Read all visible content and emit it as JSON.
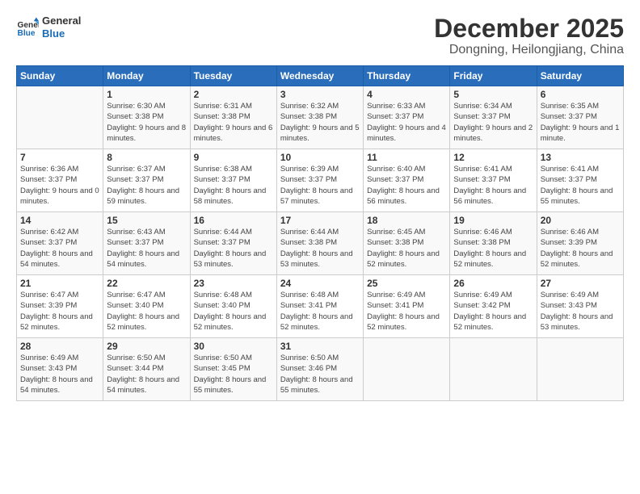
{
  "header": {
    "logo_line1": "General",
    "logo_line2": "Blue",
    "month": "December 2025",
    "location": "Dongning, Heilongjiang, China"
  },
  "days_of_week": [
    "Sunday",
    "Monday",
    "Tuesday",
    "Wednesday",
    "Thursday",
    "Friday",
    "Saturday"
  ],
  "weeks": [
    [
      {
        "day": "",
        "sunrise": "",
        "sunset": "",
        "daylight": ""
      },
      {
        "day": "1",
        "sunrise": "Sunrise: 6:30 AM",
        "sunset": "Sunset: 3:38 PM",
        "daylight": "Daylight: 9 hours and 8 minutes."
      },
      {
        "day": "2",
        "sunrise": "Sunrise: 6:31 AM",
        "sunset": "Sunset: 3:38 PM",
        "daylight": "Daylight: 9 hours and 6 minutes."
      },
      {
        "day": "3",
        "sunrise": "Sunrise: 6:32 AM",
        "sunset": "Sunset: 3:38 PM",
        "daylight": "Daylight: 9 hours and 5 minutes."
      },
      {
        "day": "4",
        "sunrise": "Sunrise: 6:33 AM",
        "sunset": "Sunset: 3:37 PM",
        "daylight": "Daylight: 9 hours and 4 minutes."
      },
      {
        "day": "5",
        "sunrise": "Sunrise: 6:34 AM",
        "sunset": "Sunset: 3:37 PM",
        "daylight": "Daylight: 9 hours and 2 minutes."
      },
      {
        "day": "6",
        "sunrise": "Sunrise: 6:35 AM",
        "sunset": "Sunset: 3:37 PM",
        "daylight": "Daylight: 9 hours and 1 minute."
      }
    ],
    [
      {
        "day": "7",
        "sunrise": "Sunrise: 6:36 AM",
        "sunset": "Sunset: 3:37 PM",
        "daylight": "Daylight: 9 hours and 0 minutes."
      },
      {
        "day": "8",
        "sunrise": "Sunrise: 6:37 AM",
        "sunset": "Sunset: 3:37 PM",
        "daylight": "Daylight: 8 hours and 59 minutes."
      },
      {
        "day": "9",
        "sunrise": "Sunrise: 6:38 AM",
        "sunset": "Sunset: 3:37 PM",
        "daylight": "Daylight: 8 hours and 58 minutes."
      },
      {
        "day": "10",
        "sunrise": "Sunrise: 6:39 AM",
        "sunset": "Sunset: 3:37 PM",
        "daylight": "Daylight: 8 hours and 57 minutes."
      },
      {
        "day": "11",
        "sunrise": "Sunrise: 6:40 AM",
        "sunset": "Sunset: 3:37 PM",
        "daylight": "Daylight: 8 hours and 56 minutes."
      },
      {
        "day": "12",
        "sunrise": "Sunrise: 6:41 AM",
        "sunset": "Sunset: 3:37 PM",
        "daylight": "Daylight: 8 hours and 56 minutes."
      },
      {
        "day": "13",
        "sunrise": "Sunrise: 6:41 AM",
        "sunset": "Sunset: 3:37 PM",
        "daylight": "Daylight: 8 hours and 55 minutes."
      }
    ],
    [
      {
        "day": "14",
        "sunrise": "Sunrise: 6:42 AM",
        "sunset": "Sunset: 3:37 PM",
        "daylight": "Daylight: 8 hours and 54 minutes."
      },
      {
        "day": "15",
        "sunrise": "Sunrise: 6:43 AM",
        "sunset": "Sunset: 3:37 PM",
        "daylight": "Daylight: 8 hours and 54 minutes."
      },
      {
        "day": "16",
        "sunrise": "Sunrise: 6:44 AM",
        "sunset": "Sunset: 3:37 PM",
        "daylight": "Daylight: 8 hours and 53 minutes."
      },
      {
        "day": "17",
        "sunrise": "Sunrise: 6:44 AM",
        "sunset": "Sunset: 3:38 PM",
        "daylight": "Daylight: 8 hours and 53 minutes."
      },
      {
        "day": "18",
        "sunrise": "Sunrise: 6:45 AM",
        "sunset": "Sunset: 3:38 PM",
        "daylight": "Daylight: 8 hours and 52 minutes."
      },
      {
        "day": "19",
        "sunrise": "Sunrise: 6:46 AM",
        "sunset": "Sunset: 3:38 PM",
        "daylight": "Daylight: 8 hours and 52 minutes."
      },
      {
        "day": "20",
        "sunrise": "Sunrise: 6:46 AM",
        "sunset": "Sunset: 3:39 PM",
        "daylight": "Daylight: 8 hours and 52 minutes."
      }
    ],
    [
      {
        "day": "21",
        "sunrise": "Sunrise: 6:47 AM",
        "sunset": "Sunset: 3:39 PM",
        "daylight": "Daylight: 8 hours and 52 minutes."
      },
      {
        "day": "22",
        "sunrise": "Sunrise: 6:47 AM",
        "sunset": "Sunset: 3:40 PM",
        "daylight": "Daylight: 8 hours and 52 minutes."
      },
      {
        "day": "23",
        "sunrise": "Sunrise: 6:48 AM",
        "sunset": "Sunset: 3:40 PM",
        "daylight": "Daylight: 8 hours and 52 minutes."
      },
      {
        "day": "24",
        "sunrise": "Sunrise: 6:48 AM",
        "sunset": "Sunset: 3:41 PM",
        "daylight": "Daylight: 8 hours and 52 minutes."
      },
      {
        "day": "25",
        "sunrise": "Sunrise: 6:49 AM",
        "sunset": "Sunset: 3:41 PM",
        "daylight": "Daylight: 8 hours and 52 minutes."
      },
      {
        "day": "26",
        "sunrise": "Sunrise: 6:49 AM",
        "sunset": "Sunset: 3:42 PM",
        "daylight": "Daylight: 8 hours and 52 minutes."
      },
      {
        "day": "27",
        "sunrise": "Sunrise: 6:49 AM",
        "sunset": "Sunset: 3:43 PM",
        "daylight": "Daylight: 8 hours and 53 minutes."
      }
    ],
    [
      {
        "day": "28",
        "sunrise": "Sunrise: 6:49 AM",
        "sunset": "Sunset: 3:43 PM",
        "daylight": "Daylight: 8 hours and 54 minutes."
      },
      {
        "day": "29",
        "sunrise": "Sunrise: 6:50 AM",
        "sunset": "Sunset: 3:44 PM",
        "daylight": "Daylight: 8 hours and 54 minutes."
      },
      {
        "day": "30",
        "sunrise": "Sunrise: 6:50 AM",
        "sunset": "Sunset: 3:45 PM",
        "daylight": "Daylight: 8 hours and 55 minutes."
      },
      {
        "day": "31",
        "sunrise": "Sunrise: 6:50 AM",
        "sunset": "Sunset: 3:46 PM",
        "daylight": "Daylight: 8 hours and 55 minutes."
      },
      {
        "day": "",
        "sunrise": "",
        "sunset": "",
        "daylight": ""
      },
      {
        "day": "",
        "sunrise": "",
        "sunset": "",
        "daylight": ""
      },
      {
        "day": "",
        "sunrise": "",
        "sunset": "",
        "daylight": ""
      }
    ]
  ]
}
